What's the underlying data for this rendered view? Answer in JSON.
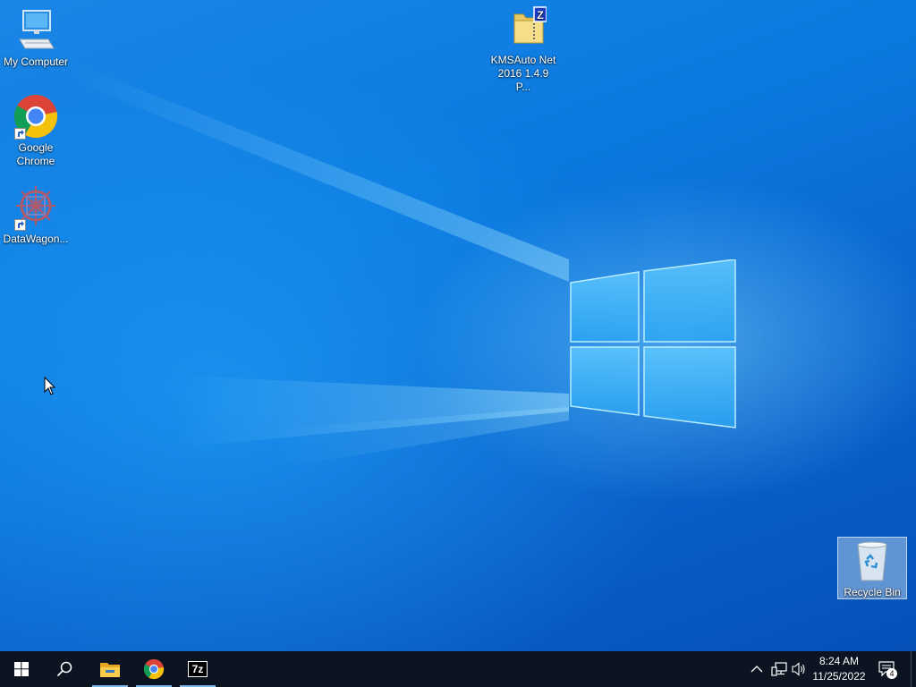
{
  "desktop": {
    "icons": [
      {
        "label": "My Computer"
      },
      {
        "label": "Google\nChrome"
      },
      {
        "label": "DataWagon..."
      },
      {
        "label": "KMSAuto Net\n2016 1.4.9 P..."
      },
      {
        "label": "Recycle Bin"
      }
    ]
  },
  "taskbar": {
    "start_icon": "windows-start-icon",
    "search_icon": "search-icon",
    "pinned": [
      {
        "name": "file-explorer-icon"
      },
      {
        "name": "chrome-icon"
      },
      {
        "name": "7zip-icon",
        "text": "7z"
      }
    ],
    "clock": {
      "time": "8:24 AM",
      "date": "11/25/2022"
    },
    "notification_count": "4"
  },
  "colors": {
    "taskbar_bg": "#0b1420",
    "desktop_blue": "#0a6fd8",
    "active_indicator": "#7cb7e8"
  }
}
